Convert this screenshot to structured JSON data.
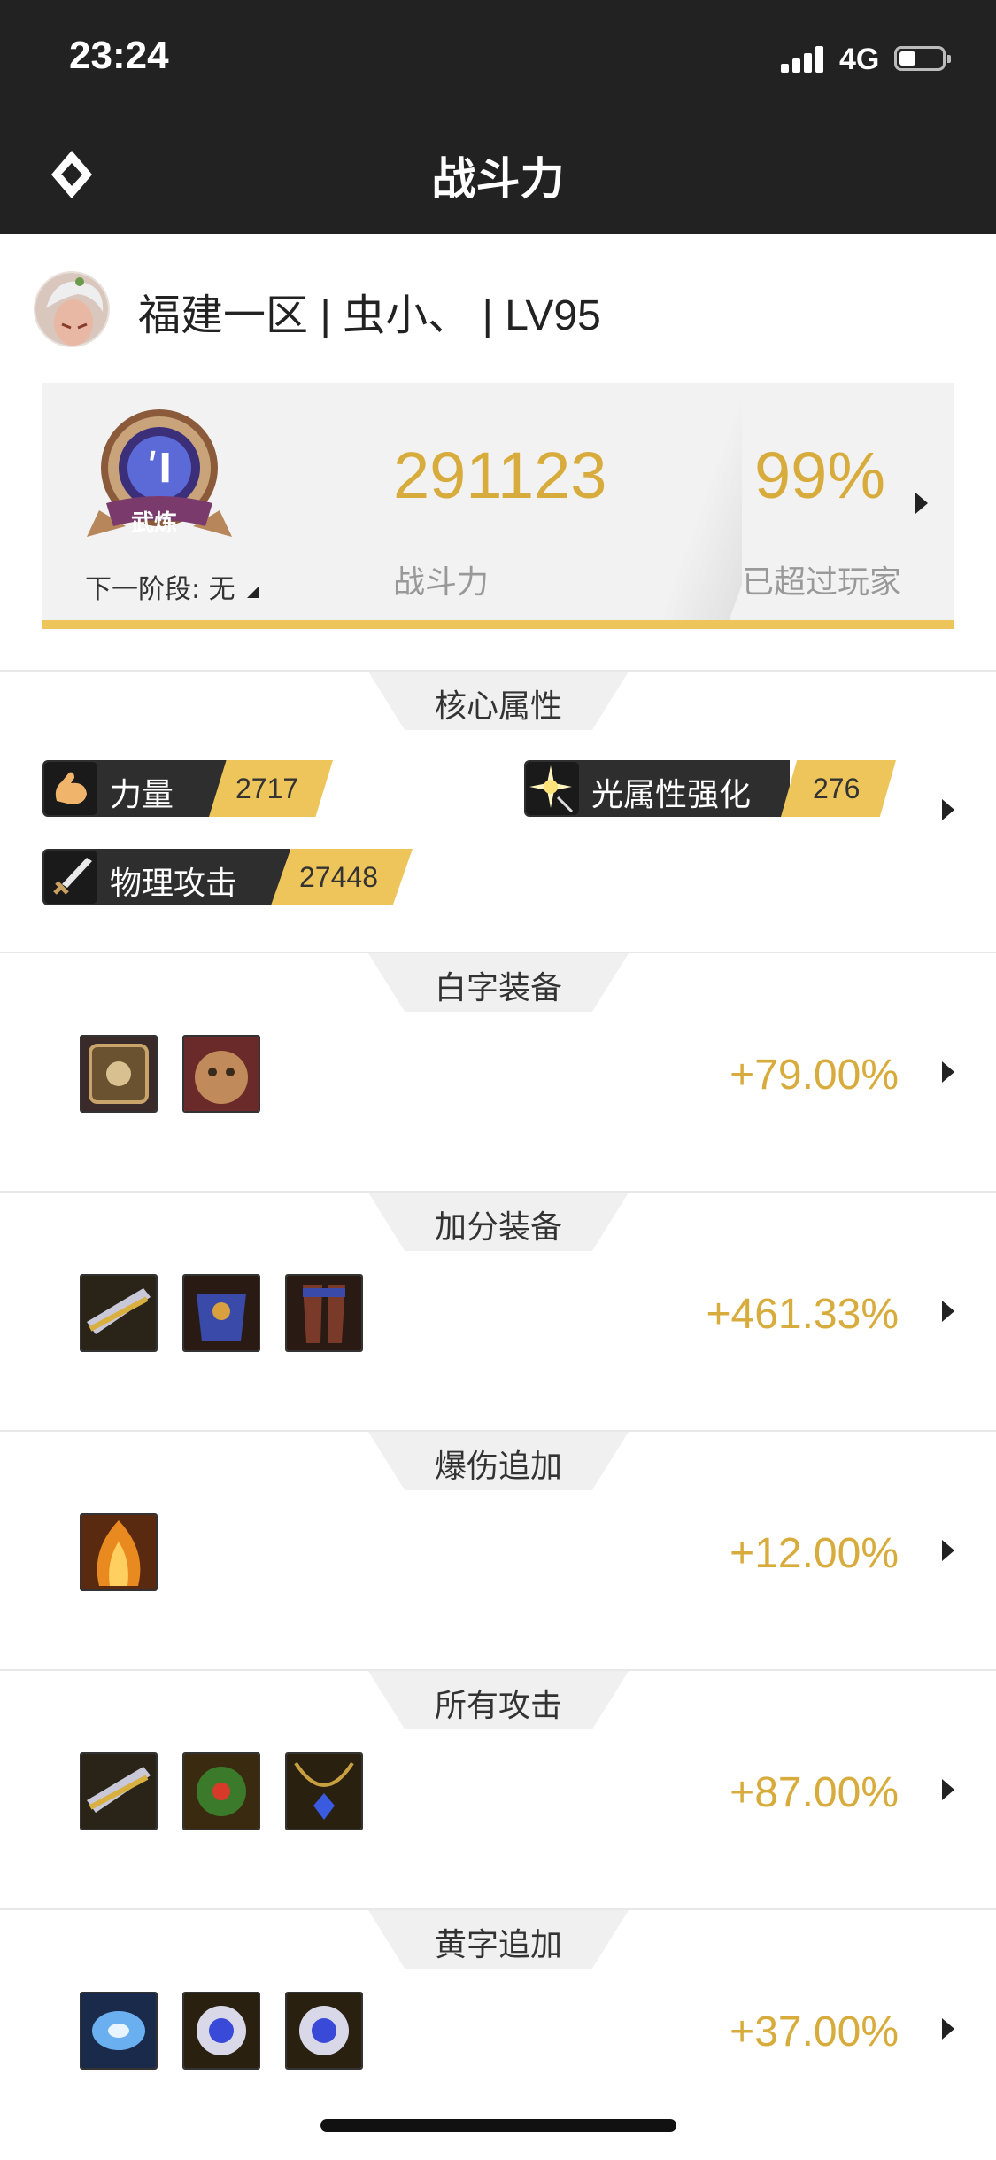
{
  "status_bar": {
    "time": "23:24",
    "network": "4G"
  },
  "nav": {
    "title": "战斗力"
  },
  "profile": {
    "text": "福建一区 | 虫小、 | LV95"
  },
  "power_card": {
    "badge_text": "武炼",
    "next_stage": "下一阶段: 无",
    "power_value": "291123",
    "power_label": "战斗力",
    "percent_value": "99%",
    "percent_label": "已超过玩家"
  },
  "core": {
    "title": "核心属性",
    "attributes": [
      {
        "name": "力量",
        "value": "2717",
        "icon": "strength-arm-icon"
      },
      {
        "name": "光属性强化",
        "value": "276",
        "icon": "light-sparkle-icon"
      },
      {
        "name": "物理攻击",
        "value": "27448",
        "icon": "sword-icon"
      }
    ]
  },
  "sections": [
    {
      "title": "白字装备",
      "value": "+79.00%",
      "icons": [
        "emblem-icon",
        "beast-helmet-icon"
      ]
    },
    {
      "title": "加分装备",
      "value": "+461.33%",
      "icons": [
        "gun-blade-icon",
        "armor-chest-icon",
        "armor-leg-icon"
      ]
    },
    {
      "title": "爆伤追加",
      "value": "+12.00%",
      "icons": [
        "fire-cape-icon"
      ]
    },
    {
      "title": "所有攻击",
      "value": "+87.00%",
      "icons": [
        "gun-blade-icon",
        "green-gem-icon",
        "blue-necklace-icon"
      ]
    },
    {
      "title": "黄字追加",
      "value": "+37.00%",
      "icons": [
        "blue-crystal-icon",
        "eye-ring-icon",
        "eye-ring-icon"
      ]
    }
  ],
  "colors": {
    "accent_gold": "#d8ac3c",
    "bar_gold": "#eec55a",
    "header_dark": "#222222"
  }
}
